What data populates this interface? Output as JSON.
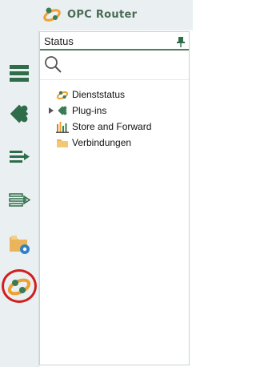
{
  "app": {
    "title": "OPC Router"
  },
  "panel": {
    "title": "Status"
  },
  "tree": {
    "items": [
      {
        "label": "Dienststatus",
        "icon": "dienststatus-icon",
        "expandable": false
      },
      {
        "label": "Plug-ins",
        "icon": "plugin-icon",
        "expandable": true
      },
      {
        "label": "Store and Forward",
        "icon": "store-forward-icon",
        "expandable": false
      },
      {
        "label": "Verbindungen",
        "icon": "folder-icon",
        "expandable": false
      }
    ]
  },
  "sidebar": {
    "buttons": [
      {
        "icon": "list-icon"
      },
      {
        "icon": "plugin-icon"
      },
      {
        "icon": "flow-icon"
      },
      {
        "icon": "flow-outline-icon"
      },
      {
        "icon": "folder-settings-icon"
      },
      {
        "icon": "status-logo-icon",
        "active": true
      }
    ]
  },
  "colors": {
    "accent": "#4e7d5f",
    "highlight": "#d01f1f",
    "orange": "#f0a030"
  }
}
